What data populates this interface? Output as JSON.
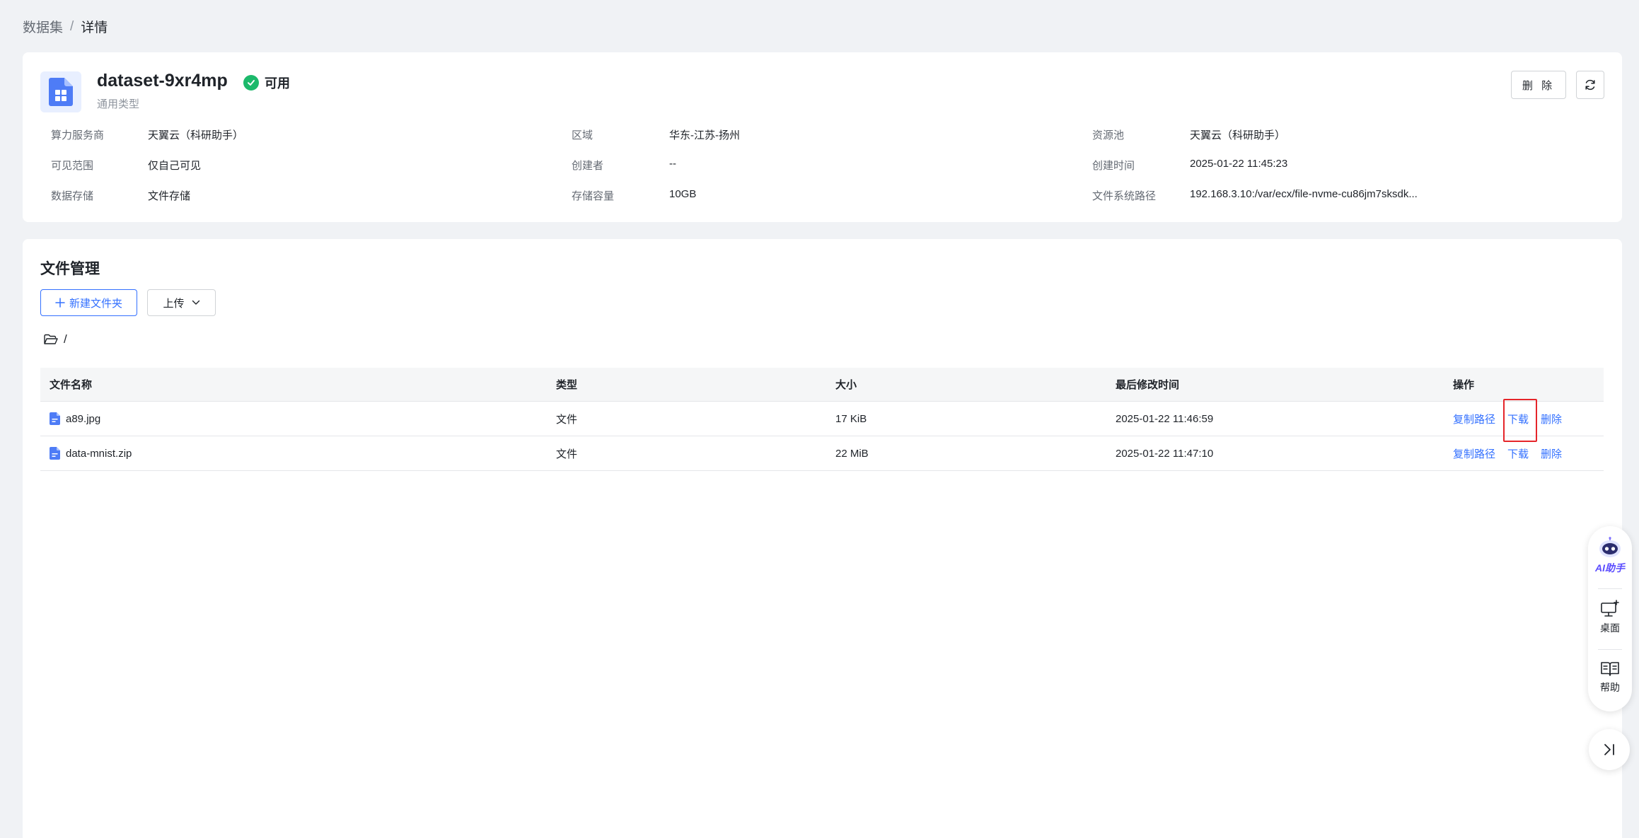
{
  "breadcrumb": {
    "parent": "数据集",
    "separator": "/",
    "current": "详情"
  },
  "dataset": {
    "name": "dataset-9xr4mp",
    "status": "可用",
    "type": "通用类型",
    "delete_label": "删 除"
  },
  "meta": {
    "provider_label": "算力服务商",
    "provider_value": "天翼云（科研助手）",
    "region_label": "区域",
    "region_value": "华东-江苏-扬州",
    "pool_label": "资源池",
    "pool_value": "天翼云（科研助手）",
    "visibility_label": "可见范围",
    "visibility_value": "仅自己可见",
    "creator_label": "创建者",
    "creator_value": "--",
    "created_label": "创建时间",
    "created_value": "2025-01-22 11:45:23",
    "storage_label": "数据存储",
    "storage_value": "文件存储",
    "capacity_label": "存储容量",
    "capacity_value": "10GB",
    "fspath_label": "文件系统路径",
    "fspath_value": "192.168.3.10:/var/ecx/file-nvme-cu86jm7sksdk..."
  },
  "files": {
    "title": "文件管理",
    "new_folder_label": "新建文件夹",
    "upload_label": "上传",
    "path": "/",
    "columns": {
      "name": "文件名称",
      "type": "类型",
      "size": "大小",
      "modified": "最后修改时间",
      "ops": "操作"
    },
    "rows": [
      {
        "name": "a89.jpg",
        "type": "文件",
        "size": "17 KiB",
        "modified": "2025-01-22 11:46:59"
      },
      {
        "name": "data-mnist.zip",
        "type": "文件",
        "size": "22 MiB",
        "modified": "2025-01-22 11:47:10"
      }
    ],
    "ops": {
      "copy": "复制路径",
      "download": "下载",
      "delete": "删除"
    }
  },
  "float_panel": {
    "ai": "AI助手",
    "desktop": "桌面",
    "help": "帮助"
  },
  "colors": {
    "primary": "#3370ff",
    "success": "#1cb96b",
    "highlight": "#e5252a"
  }
}
